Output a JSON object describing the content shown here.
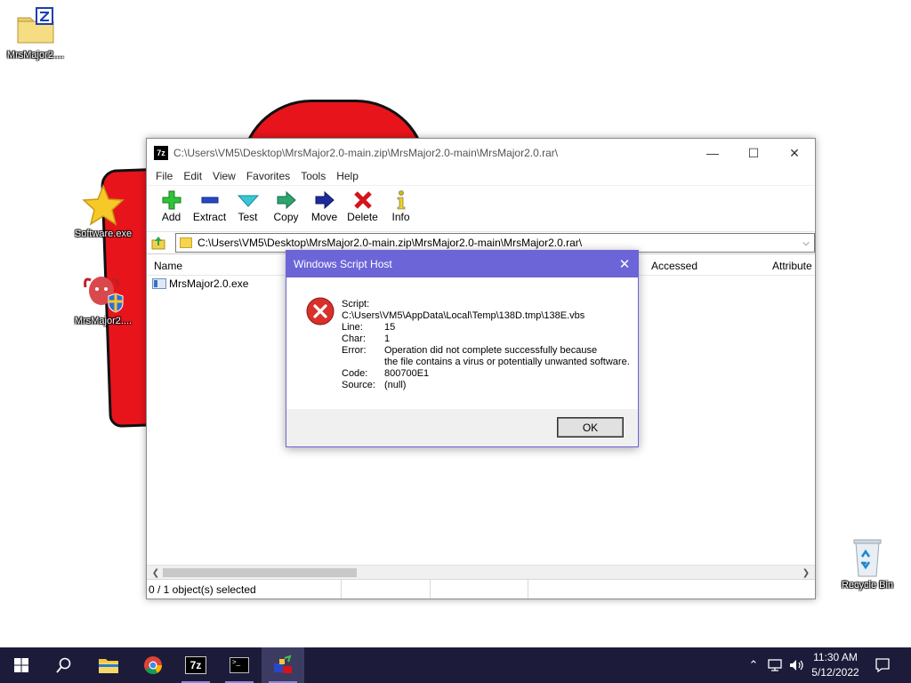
{
  "desktop": {
    "icons": [
      {
        "label": "MrsMajor2...."
      },
      {
        "label": "Software.exe"
      },
      {
        "label": "MrsMajor2...."
      },
      {
        "label": "Recycle Bin"
      }
    ]
  },
  "window": {
    "app_icon_text": "7z",
    "title": "C:\\Users\\VM5\\Desktop\\MrsMajor2.0-main.zip\\MrsMajor2.0-main\\MrsMajor2.0.rar\\",
    "controls": {
      "minimize": "—",
      "maximize": "☐",
      "close": "✕"
    },
    "menu": [
      "File",
      "Edit",
      "View",
      "Favorites",
      "Tools",
      "Help"
    ],
    "toolbar": [
      "Add",
      "Extract",
      "Test",
      "Copy",
      "Move",
      "Delete",
      "Info"
    ],
    "address": "C:\\Users\\VM5\\Desktop\\MrsMajor2.0-main.zip\\MrsMajor2.0-main\\MrsMajor2.0.rar\\",
    "columns": {
      "name": "Name",
      "accessed": "Accessed",
      "attributes": "Attribute"
    },
    "files": [
      {
        "name": "MrsMajor2.0.exe"
      }
    ],
    "status": "0 / 1 object(s) selected"
  },
  "dialog": {
    "title": "Windows Script Host",
    "close": "✕",
    "script_label": "Script:",
    "script_path": "C:\\Users\\VM5\\AppData\\Local\\Temp\\138D.tmp\\138E.vbs",
    "line_label": "Line:",
    "line_value": "15",
    "char_label": "Char:",
    "char_value": "1",
    "error_label": "Error:",
    "error_line1": "Operation did not complete successfully because",
    "error_line2": "the file contains a virus or potentially unwanted software.",
    "code_label": "Code:",
    "code_value": "800700E1",
    "source_label": "Source:",
    "source_value": "(null)",
    "ok_label": "OK"
  },
  "taskbar": {
    "clock_time": "11:30 AM",
    "clock_date": "5/12/2022"
  },
  "colors": {
    "dialog_title": "#6b65d8",
    "taskbar": "#1c1b3a",
    "error_red": "#d9302c"
  }
}
